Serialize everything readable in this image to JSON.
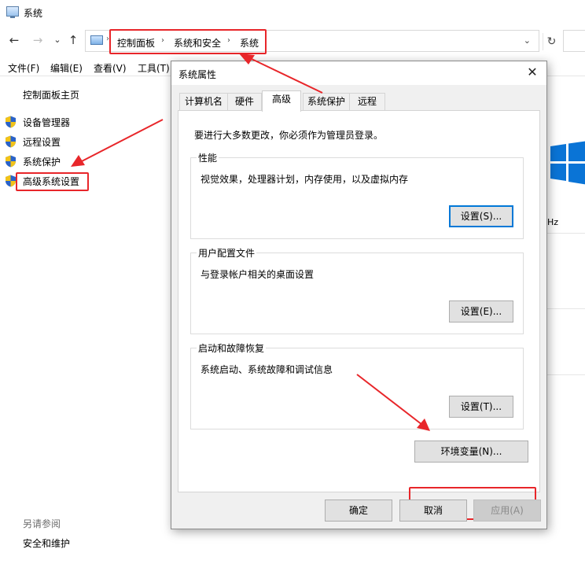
{
  "window": {
    "title": "系统"
  },
  "nav": {
    "back": "←",
    "forward": "→",
    "recent": "⌄",
    "up": "↑",
    "refresh": "↻"
  },
  "breadcrumb": [
    "控制面板",
    "系统和安全",
    "系统"
  ],
  "menu": [
    "文件(F)",
    "编辑(E)",
    "查看(V)",
    "工具(T)"
  ],
  "left_pane": {
    "home": "控制面板主页",
    "items": [
      "设备管理器",
      "远程设置",
      "系统保护",
      "高级系统设置"
    ],
    "see_also": "另请参阅",
    "security": "安全和维护"
  },
  "right_fragment": {
    "hz_text": "Hz"
  },
  "dialog": {
    "title": "系统属性",
    "close": "✕",
    "tabs": [
      "计算机名",
      "硬件",
      "高级",
      "系统保护",
      "远程"
    ],
    "active_tab": "高级",
    "admin_note": "要进行大多数更改，你必须作为管理员登录。",
    "performance": {
      "title": "性能",
      "desc": "视觉效果，处理器计划，内存使用，以及虚拟内存",
      "button": "设置(S)..."
    },
    "user_profiles": {
      "title": "用户配置文件",
      "desc": "与登录帐户相关的桌面设置",
      "button": "设置(E)..."
    },
    "startup": {
      "title": "启动和故障恢复",
      "desc": "系统启动、系统故障和调试信息",
      "button": "设置(T)..."
    },
    "env_button": "环境变量(N)...",
    "ok": "确定",
    "cancel": "取消",
    "apply": "应用(A)"
  },
  "colors": {
    "highlight": "#e8262a",
    "focus": "#0078d7",
    "win_blue": "#0a74d6",
    "shield_blue": "#2a63c9",
    "shield_yellow": "#f2c318"
  }
}
